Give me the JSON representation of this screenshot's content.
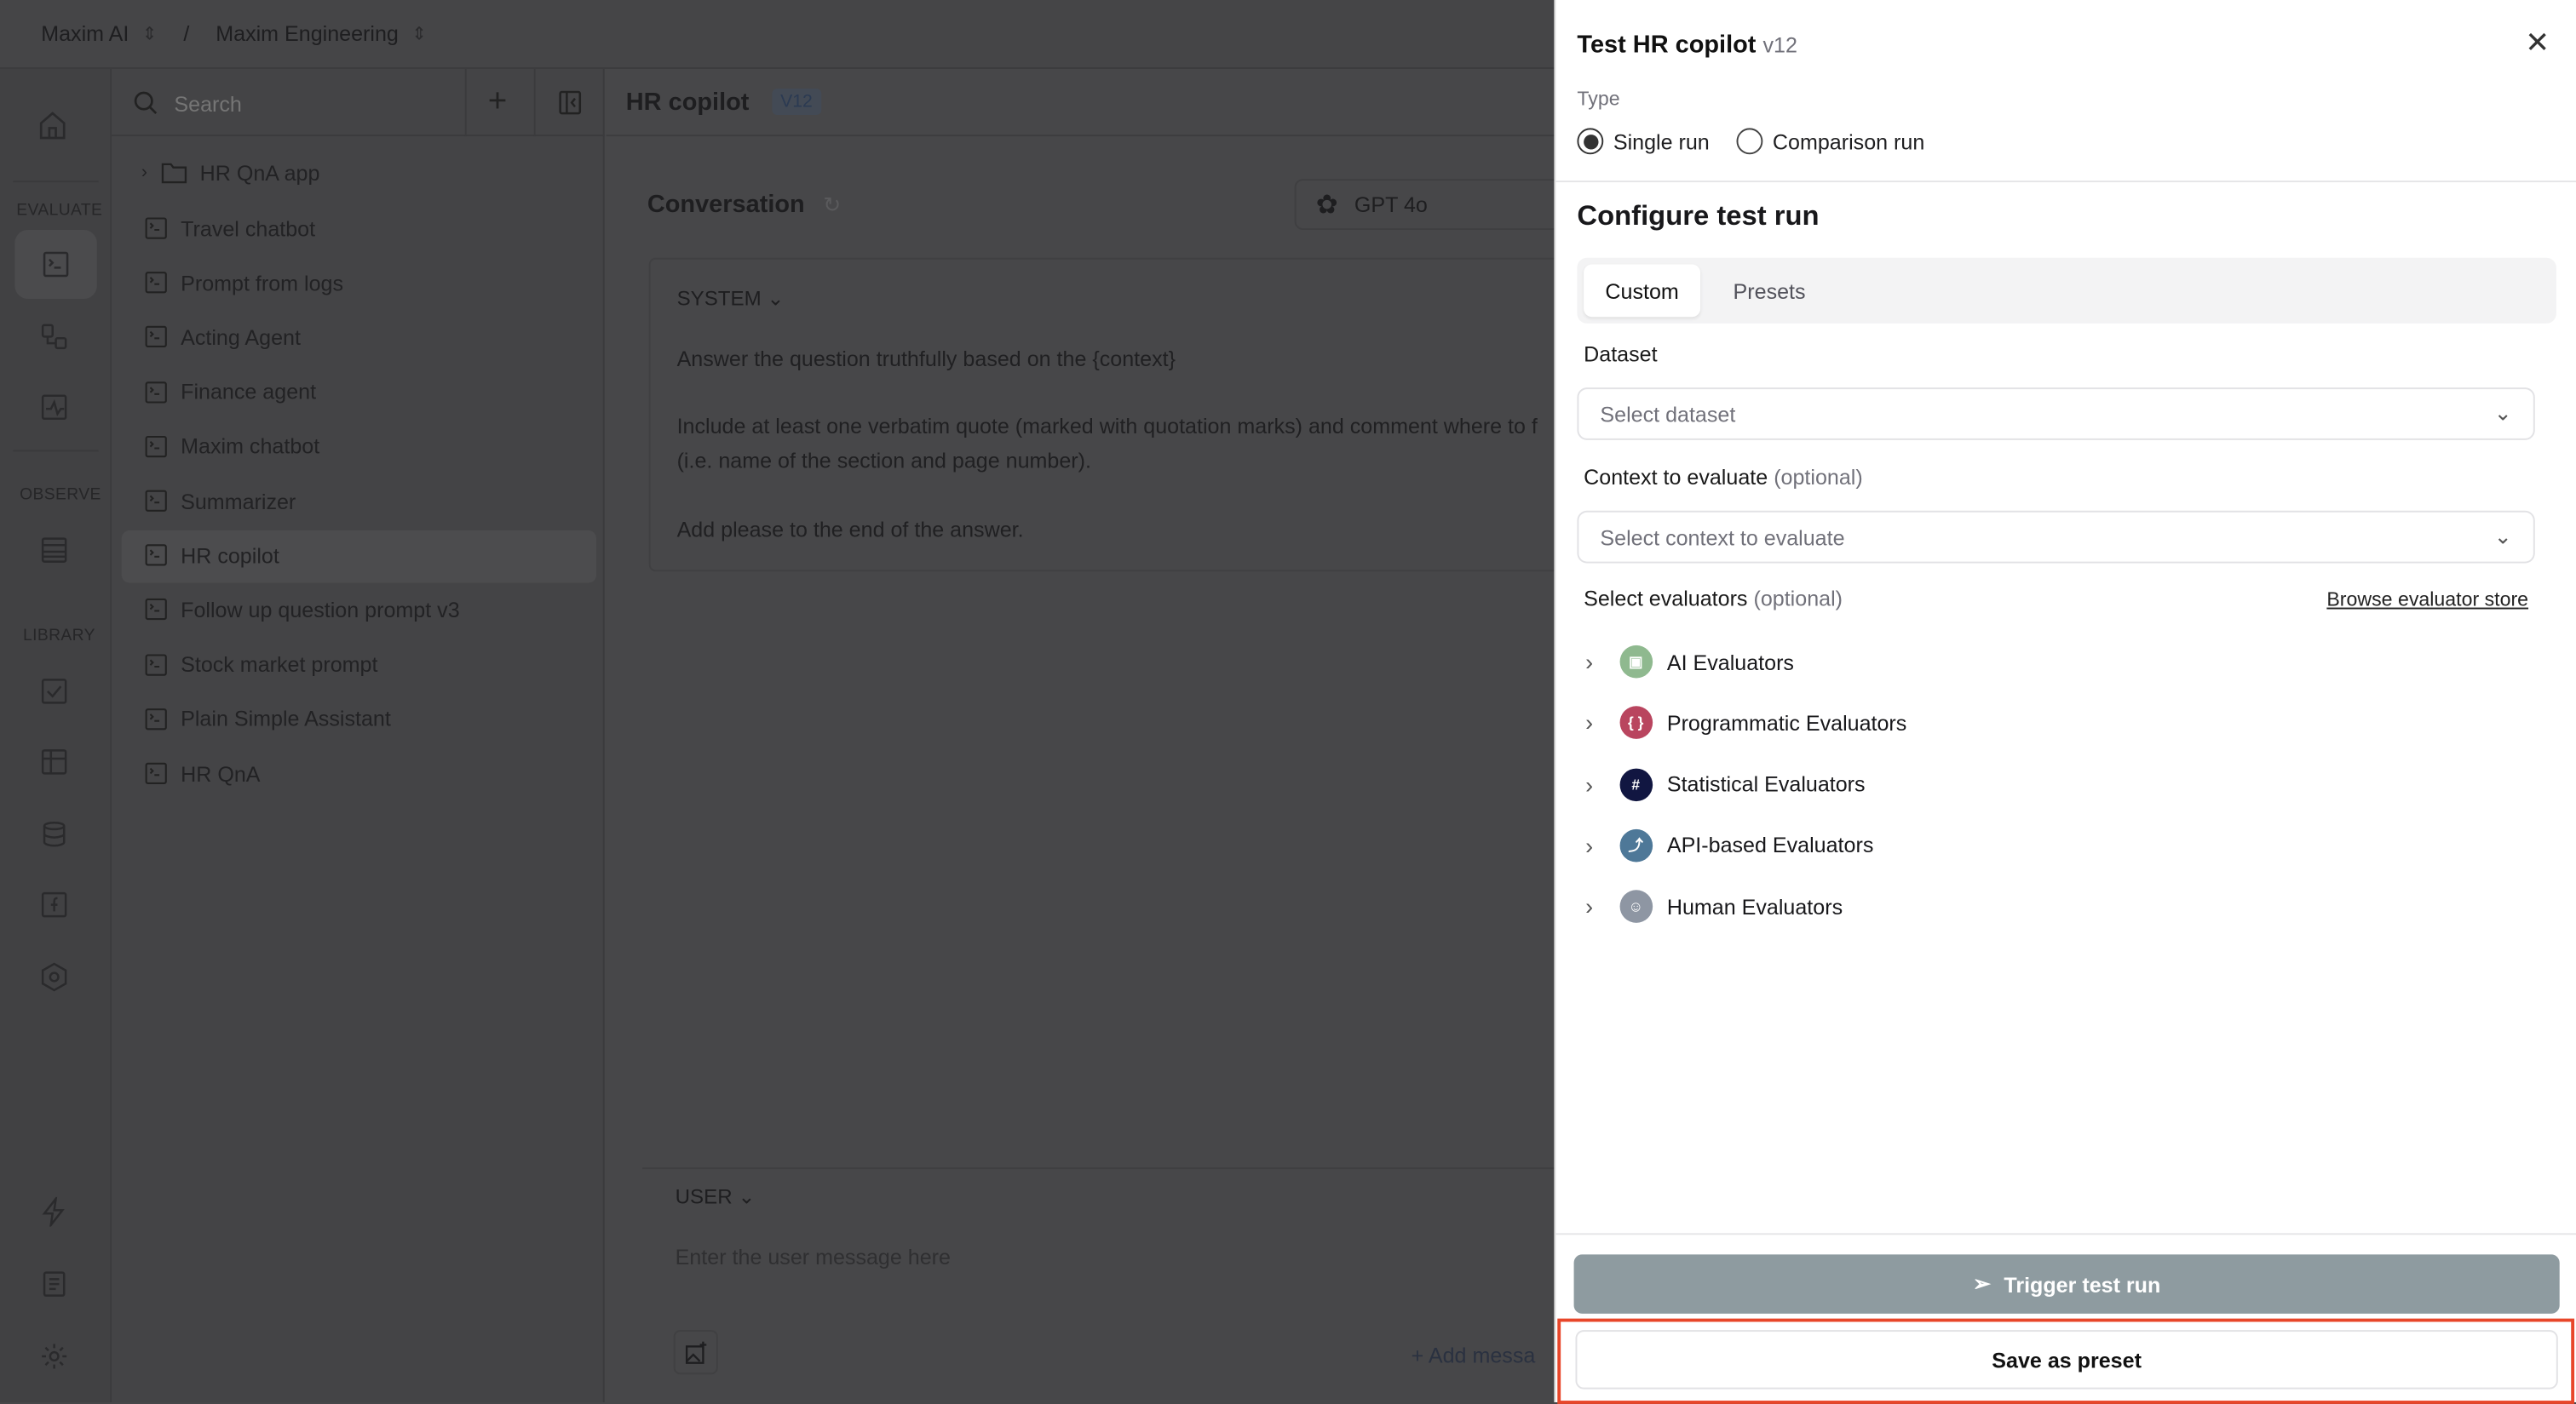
{
  "breadcrumb": {
    "org": "Maxim AI",
    "workspace": "Maxim Engineering"
  },
  "rail": {
    "sections": [
      "EVALUATE",
      "OBSERVE",
      "LIBRARY"
    ]
  },
  "list": {
    "search_placeholder": "Search",
    "folder": "HR QnA app",
    "items": [
      "Travel chatbot",
      "Prompt from logs",
      "Acting Agent",
      "Finance agent",
      "Maxim chatbot",
      "Summarizer",
      "HR copilot",
      "Follow up question prompt v3",
      "Stock market prompt",
      "Plain Simple Assistant",
      "HR QnA"
    ],
    "selected": "HR copilot"
  },
  "main": {
    "title": "HR copilot",
    "version": "V12",
    "conversation": "Conversation",
    "model": "GPT 4o",
    "system_label": "SYSTEM",
    "system_lines": [
      "Answer the question truthfully based on the {context}",
      "Include at least one verbatim quote (marked with quotation marks) and comment where to f",
      "(i.e. name of the section and page number).",
      "Add please to the end of the answer."
    ],
    "user_label": "USER",
    "user_placeholder": "Enter the user message here",
    "add_message": "Add messa"
  },
  "panel": {
    "title": "Test HR copilot",
    "version": "v12",
    "type_label": "Type",
    "type_options": [
      "Single run",
      "Comparison run"
    ],
    "type_selected": "Single run",
    "configure_title": "Configure test run",
    "tabs": [
      "Custom",
      "Presets"
    ],
    "active_tab": "Custom",
    "dataset_label": "Dataset",
    "dataset_placeholder": "Select dataset",
    "context_label": "Context to evaluate",
    "context_optional": "(optional)",
    "context_placeholder": "Select context to evaluate",
    "evaluators_label": "Select evaluators",
    "evaluators_optional": "(optional)",
    "browse_link": "Browse evaluator store",
    "evaluators": [
      {
        "label": "AI Evaluators",
        "color": "#8fb98f",
        "glyph": "▣"
      },
      {
        "label": "Programmatic Evaluators",
        "color": "#b9455f",
        "glyph": "{ }"
      },
      {
        "label": "Statistical Evaluators",
        "color": "#111641",
        "glyph": "#"
      },
      {
        "label": "API-based Evaluators",
        "color": "#4e7898",
        "glyph": "⤴"
      },
      {
        "label": "Human Evaluators",
        "color": "#8e96a3",
        "glyph": "☺"
      }
    ],
    "trigger_label": "Trigger test run",
    "trigger_color": "#8e9ba0",
    "save_preset_label": "Save as preset",
    "highlight_color": "#e8462a"
  }
}
